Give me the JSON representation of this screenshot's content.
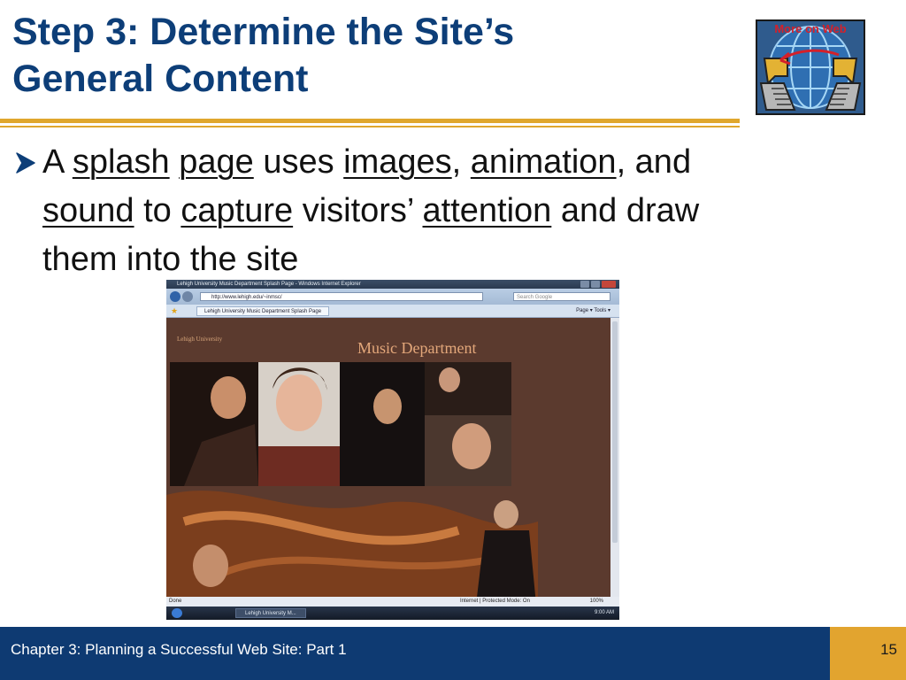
{
  "slide": {
    "title_line1": "Step 3: Determine the Site’s",
    "title_line2": "General Content",
    "badge_text": "More on Web",
    "bullet": {
      "w1": "A",
      "w2": "splash",
      "w3": "page",
      "w4": "uses",
      "w5": "images",
      "w6": ",",
      "w7": "animation",
      "w8": ", and",
      "w9": "sound",
      "w10": "to",
      "w11": "capture",
      "w12": "visitors’",
      "w13": "attention",
      "w14": "and draw",
      "w15": "them into the site"
    },
    "footer_text": "Chapter 3: Planning a Successful Web Site: Part 1",
    "page_number": "15"
  },
  "screenshot": {
    "window_title": "Lehigh University Music Department Splash Page - Windows Internet Explorer",
    "address": "http://www.lehigh.edu/~inmsc/",
    "search_placeholder": "Search Google",
    "tab_label": "Lehigh University Music Department Splash Page",
    "toolbar_right": "Page ▾   Tools ▾",
    "site_logo": "Lehigh University",
    "site_heading": "Music Department",
    "status_left": "Done",
    "status_zone": "Internet | Protected Mode: On",
    "zoom": "100%",
    "taskbar_item": "Lehigh University M...",
    "clock": "9:00 AM"
  },
  "colors": {
    "title": "#0d3e78",
    "rule": "#e0a72d",
    "footer_bg": "#0e3a72",
    "page_box_bg": "#e2a42f",
    "site_bg": "#5b3a2e"
  },
  "icons": {
    "bullet": "arrow-bullet-icon",
    "badge": "more-on-web-icon"
  }
}
